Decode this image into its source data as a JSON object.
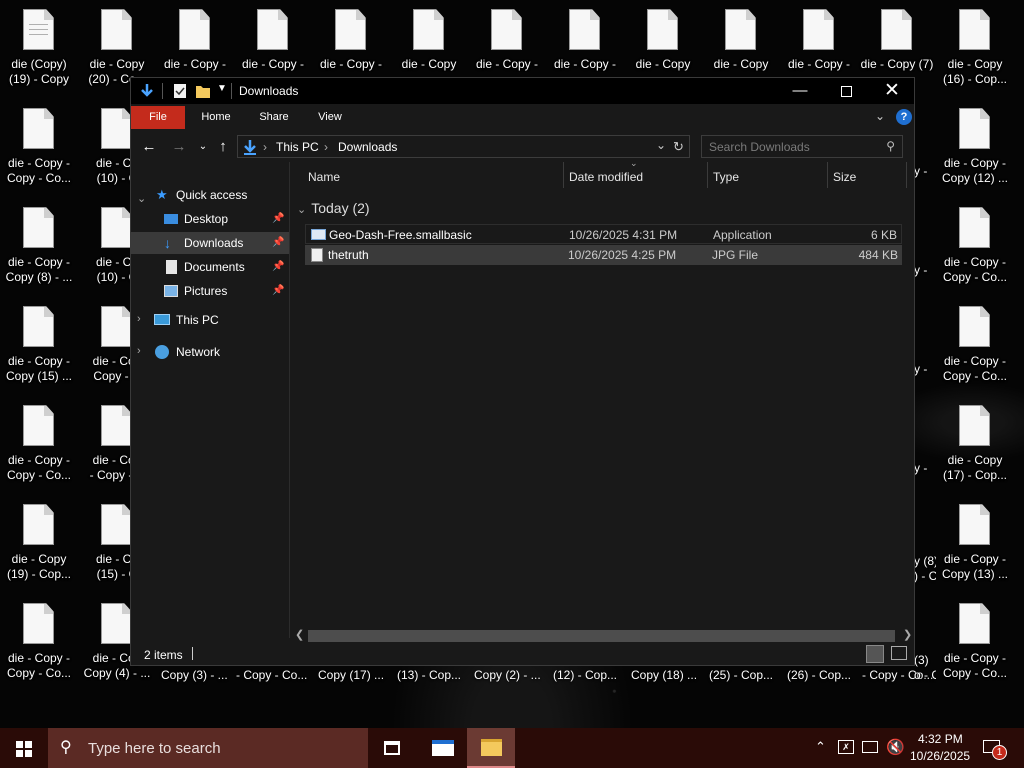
{
  "desktop": {
    "icons": [
      {
        "label": "die (Copy)\n(19) - Copy"
      },
      {
        "label": "die - Copy\n(20) - Co..."
      },
      {
        "label": "die - Copy -"
      },
      {
        "label": "die - Copy -"
      },
      {
        "label": "die - Copy -"
      },
      {
        "label": "die - Copy"
      },
      {
        "label": "die - Copy -"
      },
      {
        "label": "die - Copy -"
      },
      {
        "label": "die - Copy"
      },
      {
        "label": "die - Copy"
      },
      {
        "label": "die - Copy -"
      },
      {
        "label": "die - Copy (7)"
      },
      {
        "label": "die - Copy\n(16) - Cop..."
      },
      {
        "label": "die - Copy -\nCopy - Co..."
      },
      {
        "label": "die - Co\n(10) - C"
      },
      {
        "label": "die - Copy -\nCopy (12) ..."
      },
      {
        "label": "die - Copy -\nCopy (8) - ..."
      },
      {
        "label": "die - Co\n(10) - C"
      },
      {
        "label": "die - Copy -\nCopy - Co..."
      },
      {
        "label": "die - Copy -\nCopy (15) ..."
      },
      {
        "label": "die - Cop\nCopy - C"
      },
      {
        "label": "die - Copy -\nCopy - Co..."
      },
      {
        "label": "die - Copy -\nCopy - Co..."
      },
      {
        "label": "die - Cop\n- Copy - C"
      },
      {
        "label": "die - Copy\n(17) - Cop..."
      },
      {
        "label": "die - Copy\n(19) - Cop..."
      },
      {
        "label": "die - Co\n(15) - C"
      },
      {
        "label": "die - Copy -\nCopy (13) ..."
      },
      {
        "label": "die - Copy -\nCopy - Co..."
      },
      {
        "label": "die - Cop\nCopy (4) - ..."
      },
      {
        "label": "die - Copy -\nCopy - Co..."
      }
    ],
    "peek_labels": [
      "Copy (3) - ...",
      "- Copy - Co...",
      "Copy (17) ...",
      "(13) - Cop...",
      "Copy (2) - ...",
      "(12) - Cop...",
      "Copy (18) ...",
      "(25) - Cop...",
      "(26) - Cop...",
      "- Copy - Co..."
    ],
    "right_peek": [
      "y -",
      "y -",
      "y -",
      "y -",
      "y (8)\n) - Co",
      "(3)\no - Co"
    ]
  },
  "window": {
    "title": "Downloads",
    "ribbon_tabs": [
      "File",
      "Home",
      "Share",
      "View"
    ],
    "breadcrumb": [
      "This PC",
      "Downloads"
    ],
    "search_placeholder": "Search Downloads",
    "nav": {
      "quick_access": "Quick access",
      "desktop": "Desktop",
      "downloads": "Downloads",
      "documents": "Documents",
      "pictures": "Pictures",
      "this_pc": "This PC",
      "network": "Network"
    },
    "columns": [
      "Name",
      "Date modified",
      "Type",
      "Size"
    ],
    "group_header": "Today (2)",
    "files": [
      {
        "name": "Geo-Dash-Free.smallbasic",
        "date": "10/26/2025 4:31 PM",
        "type": "Application",
        "size": "6 KB"
      },
      {
        "name": "thetruth",
        "date": "10/26/2025 4:25 PM",
        "type": "JPG File",
        "size": "484 KB"
      }
    ],
    "status": "2 items"
  },
  "taskbar": {
    "search_placeholder": "Type here to search",
    "time": "4:32 PM",
    "date": "10/26/2025",
    "notification_count": "1"
  },
  "colors": {
    "accent_file_tab": "#c42b1c",
    "taskbar": "#2a0b07",
    "taskbar_search": "#5b2a24",
    "selection": "#3a3a3a"
  }
}
